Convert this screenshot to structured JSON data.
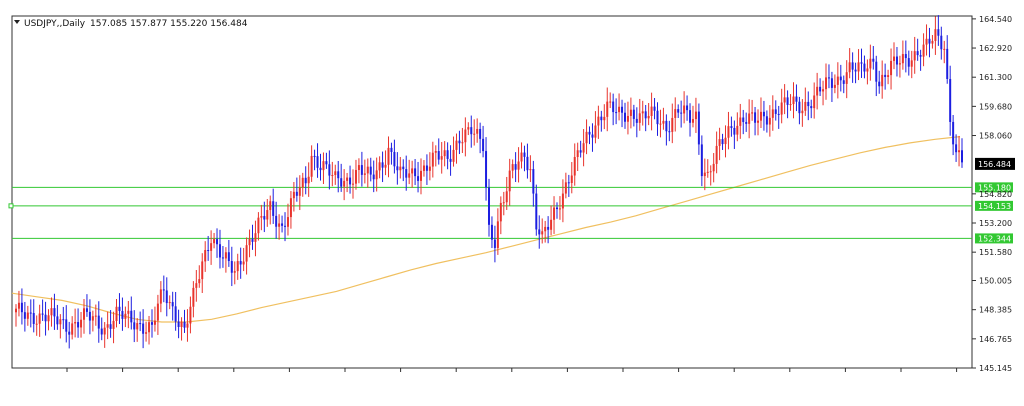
{
  "header": {
    "symbol_label": "USDJPY,,Daily",
    "ohlc": "157.085 157.877 155.220 156.484",
    "menu_icon": "triangle-down-icon"
  },
  "colors": {
    "bull": "#e8332c",
    "bear": "#1c1ee0",
    "ma": "#f0c060",
    "hline": "#32c832",
    "frame": "#303030",
    "price_label_bg": "#000000"
  },
  "chart_data": {
    "type": "candlestick",
    "title": "USDJPY,,Daily",
    "ylim": [
      145.145,
      164.7
    ],
    "y_ticks": [
      "164.540",
      "162.920",
      "161.300",
      "159.680",
      "158.060",
      "154.820",
      "153.200",
      "151.580",
      "150.005",
      "148.385",
      "146.765",
      "145.145"
    ],
    "current_price": "156.484",
    "horizontal_lines": [
      {
        "value": 155.18,
        "label": "155.180"
      },
      {
        "value": 154.153,
        "label": "154.153"
      },
      {
        "value": 152.344,
        "label": "152.344"
      }
    ],
    "moving_average": [
      149.3,
      149.1,
      148.9,
      148.6,
      148.2,
      147.85,
      147.7,
      147.7,
      147.85,
      148.15,
      148.5,
      148.8,
      149.1,
      149.4,
      149.8,
      150.2,
      150.6,
      150.95,
      151.25,
      151.55,
      151.9,
      152.25,
      152.6,
      152.95,
      153.25,
      153.6,
      154.0,
      154.4,
      154.8,
      155.2,
      155.6,
      156.0,
      156.4,
      156.75,
      157.1,
      157.4,
      157.65,
      157.85,
      158.0
    ],
    "candle_path": [
      [
        0,
        148.2
      ],
      [
        10,
        148.0
      ],
      [
        18,
        147.5
      ],
      [
        24,
        148.0
      ],
      [
        30,
        147.4
      ],
      [
        34,
        148.1
      ],
      [
        42,
        147.6
      ],
      [
        46,
        147.3
      ],
      [
        48,
        148.5
      ],
      [
        50,
        149.4
      ],
      [
        54,
        148.2
      ],
      [
        57,
        147.2
      ],
      [
        60,
        149.0
      ],
      [
        63,
        151.0
      ],
      [
        66,
        152.6
      ],
      [
        70,
        151.2
      ],
      [
        74,
        150.4
      ],
      [
        78,
        152.0
      ],
      [
        82,
        153.0
      ],
      [
        86,
        154.0
      ],
      [
        90,
        153.0
      ],
      [
        94,
        154.6
      ],
      [
        98,
        155.4
      ],
      [
        100,
        157.0
      ],
      [
        104,
        156.4
      ],
      [
        108,
        155.5
      ],
      [
        112,
        155.6
      ],
      [
        116,
        156.2
      ],
      [
        120,
        155.6
      ],
      [
        124,
        156.6
      ],
      [
        126,
        157.4
      ],
      [
        130,
        155.8
      ],
      [
        134,
        155.9
      ],
      [
        138,
        156.3
      ],
      [
        142,
        156.8
      ],
      [
        146,
        156.8
      ],
      [
        150,
        158.0
      ],
      [
        154,
        158.2
      ],
      [
        158,
        157.6
      ],
      [
        160,
        153.0
      ],
      [
        162,
        152.3
      ],
      [
        164,
        154.0
      ],
      [
        166,
        154.9
      ],
      [
        168,
        156.2
      ],
      [
        172,
        157.2
      ],
      [
        174,
        156.2
      ],
      [
        176,
        153.0
      ],
      [
        178,
        152.2
      ],
      [
        180,
        153.0
      ],
      [
        184,
        154.6
      ],
      [
        188,
        156.0
      ],
      [
        192,
        157.6
      ],
      [
        196,
        158.8
      ],
      [
        200,
        159.6
      ],
      [
        204,
        159.2
      ],
      [
        208,
        159.4
      ],
      [
        212,
        159.0
      ],
      [
        216,
        159.2
      ],
      [
        220,
        158.6
      ],
      [
        224,
        159.4
      ],
      [
        228,
        159.0
      ],
      [
        230,
        159.2
      ],
      [
        232,
        156.4
      ],
      [
        234,
        155.8
      ],
      [
        236,
        156.6
      ],
      [
        238,
        157.4
      ],
      [
        242,
        158.6
      ],
      [
        246,
        159.0
      ],
      [
        250,
        158.8
      ],
      [
        254,
        159.2
      ],
      [
        258,
        159.6
      ],
      [
        262,
        159.8
      ],
      [
        266,
        159.7
      ],
      [
        270,
        160.2
      ],
      [
        274,
        160.8
      ],
      [
        278,
        161.2
      ],
      [
        282,
        161.8
      ],
      [
        286,
        161.6
      ],
      [
        290,
        162.3
      ],
      [
        292,
        161.0
      ],
      [
        296,
        161.8
      ],
      [
        300,
        162.3
      ],
      [
        304,
        162.6
      ],
      [
        308,
        162.9
      ],
      [
        311,
        163.6
      ],
      [
        314,
        163.2
      ],
      [
        316,
        159.0
      ],
      [
        318,
        157.0
      ],
      [
        320,
        156.5
      ]
    ]
  }
}
